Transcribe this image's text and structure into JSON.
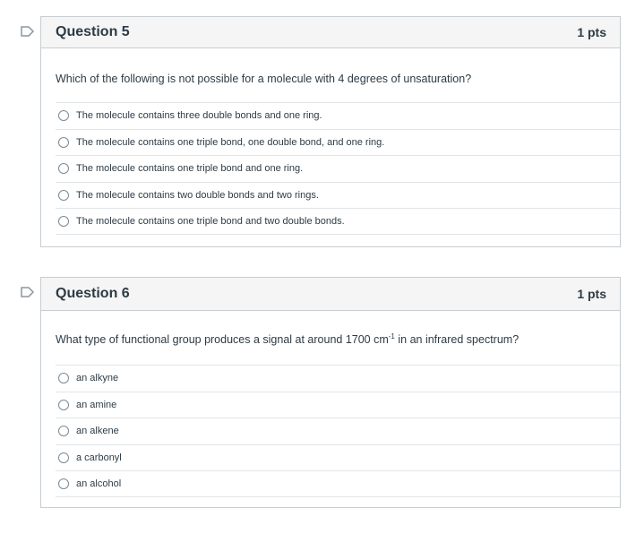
{
  "questions": [
    {
      "title": "Question 5",
      "points": "1 pts",
      "text": "Which of the following is not possible for a molecule with 4 degrees of unsaturation?",
      "answers": [
        "The molecule contains three double bonds and one ring.",
        "The molecule contains one triple bond, one double bond, and one ring.",
        "The molecule contains one triple bond and one ring.",
        "The molecule contains two double bonds and two rings.",
        "The molecule contains one triple bond and two double bonds."
      ]
    },
    {
      "title": "Question 6",
      "points": "1 pts",
      "text_before": "What type of functional group produces a signal at around 1700 cm",
      "text_sup": "-1",
      "text_after": " in an infrared spectrum?",
      "answers": [
        "an alkyne",
        "an amine",
        "an alkene",
        "a carbonyl",
        "an alcohol"
      ]
    }
  ],
  "colors": {
    "header_bg": "#f5f5f5",
    "border": "#c7cdd1",
    "text": "#2d3b45",
    "flag": "#8b969e"
  },
  "icons": {
    "flag": "flag-outline-icon",
    "radio": "radio-unselected-icon"
  }
}
